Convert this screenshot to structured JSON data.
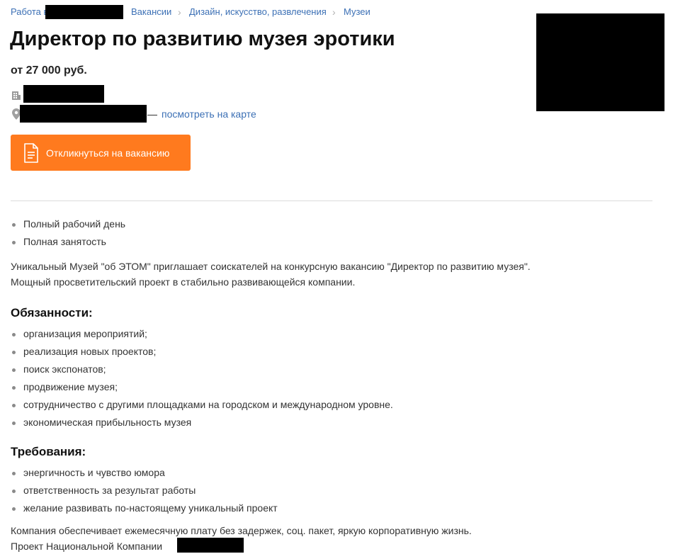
{
  "breadcrumb": {
    "items": [
      {
        "label": "Работа в"
      },
      {
        "label": "Вакансии"
      },
      {
        "label": "Дизайн, искусство, развлечения"
      },
      {
        "label": "Музеи"
      }
    ],
    "separator": "›"
  },
  "vacancy": {
    "title": "Директор по развитию музея эротики",
    "salary": "от 27 000 руб.",
    "map_link": "посмотреть на карте",
    "dash": "—",
    "apply_button": "Откликнуться на вакансию"
  },
  "conditions": [
    "Полный рабочий день",
    "Полная занятость"
  ],
  "intro": [
    "Уникальный Музей \"об ЭТОМ\" приглашает соискателей на конкурсную вакансию \"Директор по развитию музея\".",
    "Мощный просветительский проект в стабильно развивающейся компании."
  ],
  "duties": {
    "heading": "Обязанности:",
    "items": [
      "организация мероприятий;",
      "реализация новых проектов;",
      "поиск экспонатов;",
      "продвижение музея;",
      "сотрудничество с другими площадками на городском и международном уровне.",
      "экономическая прибыльность музея"
    ]
  },
  "requirements": {
    "heading": "Требования:",
    "items": [
      "энергичность и чувство юмора",
      "ответственность за результат работы",
      "желание развивать по-настоящему уникальный проект"
    ]
  },
  "footer": [
    "Компания обеспечивает ежемесячную плату без задержек, соц. пакет, яркую корпоративную жизнь.",
    "Проект Национальной Компании"
  ],
  "colors": {
    "link": "#3c70b5",
    "accent": "#ff7a1e",
    "redaction": "#000000"
  },
  "icons": {
    "company": "building-icon",
    "location": "map-pin-icon",
    "apply": "document-icon"
  }
}
